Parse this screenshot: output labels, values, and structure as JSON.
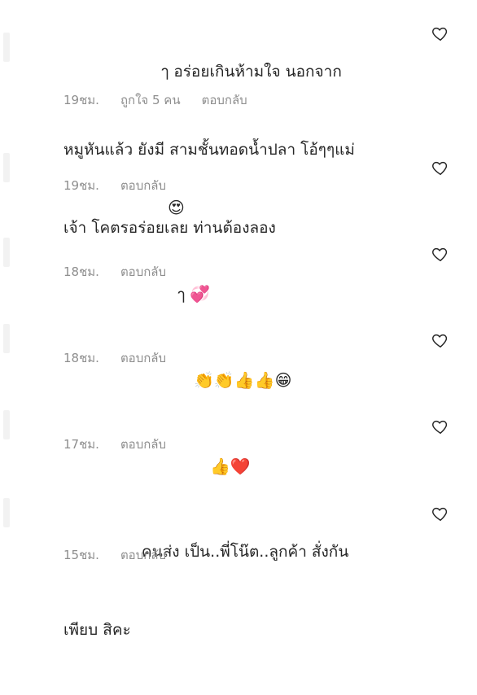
{
  "comments": [
    {
      "text_lines": [
        "ๅ อร่อยเกินห้ามใจ นอกจาก",
        "หมูหันแล้ว ยังมี สามชั้นทอดน้ำปลา โอ้ๆๆแม่",
        "เจ้า โคตรอร่อยเลย ท่านต้องลอง"
      ],
      "time": "19ชม.",
      "likes": "ถูกใจ 5 คน",
      "reply": "ตอบกลับ"
    },
    {
      "emoji": "😍",
      "time": "19ชม.",
      "reply": "ตอบกลับ"
    },
    {
      "text": "ๅ",
      "emoji": "💞",
      "time": "18ชม.",
      "reply": "ตอบกลับ"
    },
    {
      "emoji": "👏👏👍👍😁",
      "time": "18ชม.",
      "reply": "ตอบกลับ"
    },
    {
      "emoji": "👍❤️",
      "time": "17ชม.",
      "reply": "ตอบกลับ"
    },
    {
      "text_lines": [
        "คนส่ง เป็น..พี่โน๊ต..ลูกค้า สั่งกัน",
        "เพียบ สิคะ"
      ],
      "time": "15ชม.",
      "reply": "ตอบกลับ"
    }
  ],
  "icons": {
    "like": "heart-outline-icon"
  },
  "colors": {
    "text": "#262626",
    "meta": "#8e8e8e",
    "icon": "#262626"
  }
}
